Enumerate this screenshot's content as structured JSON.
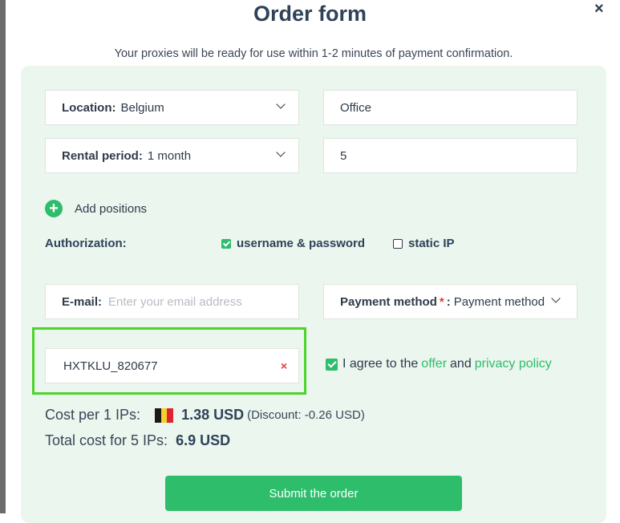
{
  "dialog": {
    "title": "Order form",
    "close_icon": "×",
    "subtitle": "Your proxies will be ready for use within 1-2 minutes of payment confirmation."
  },
  "form": {
    "location": {
      "label": "Location:",
      "value": "Belgium"
    },
    "purpose": {
      "value": "Office"
    },
    "rental_period": {
      "label": "Rental period:",
      "value": "1 month"
    },
    "quantity": {
      "value": "5"
    },
    "add_positions": {
      "icon": "+",
      "label": "Add positions"
    },
    "authorization": {
      "label": "Authorization:",
      "options": [
        {
          "label": "username & password",
          "checked": true
        },
        {
          "label": "static IP",
          "checked": false
        }
      ]
    },
    "email": {
      "label": "E-mail:",
      "value": "",
      "placeholder": "Enter your email address"
    },
    "payment": {
      "label": "Payment method",
      "required_mark": "*",
      "colon": ":",
      "value": "Payment method"
    },
    "coupon": {
      "value": "HXTKLU_820677",
      "clear_icon": "×"
    },
    "agree": {
      "text_before": "I agree to the",
      "offer_link": "offer",
      "and_text": "and",
      "privacy_link": "privacy policy",
      "checked": true
    }
  },
  "pricing": {
    "cost_label": "Cost per 1 IPs:",
    "flag": "belgium-flag",
    "cost_value": "1.38 USD",
    "discount": "(Discount: -0.26 USD)",
    "total_label": "Total cost for 5 IPs:",
    "total_value": "6.9 USD"
  },
  "submit_label": "Submit the order",
  "colors": {
    "accent": "#2ebd6b",
    "panel_bg": "#eaf6ee",
    "highlight": "#4cd42a",
    "required": "#e53935",
    "flag": [
      "#1a1a1a",
      "#f6d02f",
      "#e0252f"
    ]
  }
}
